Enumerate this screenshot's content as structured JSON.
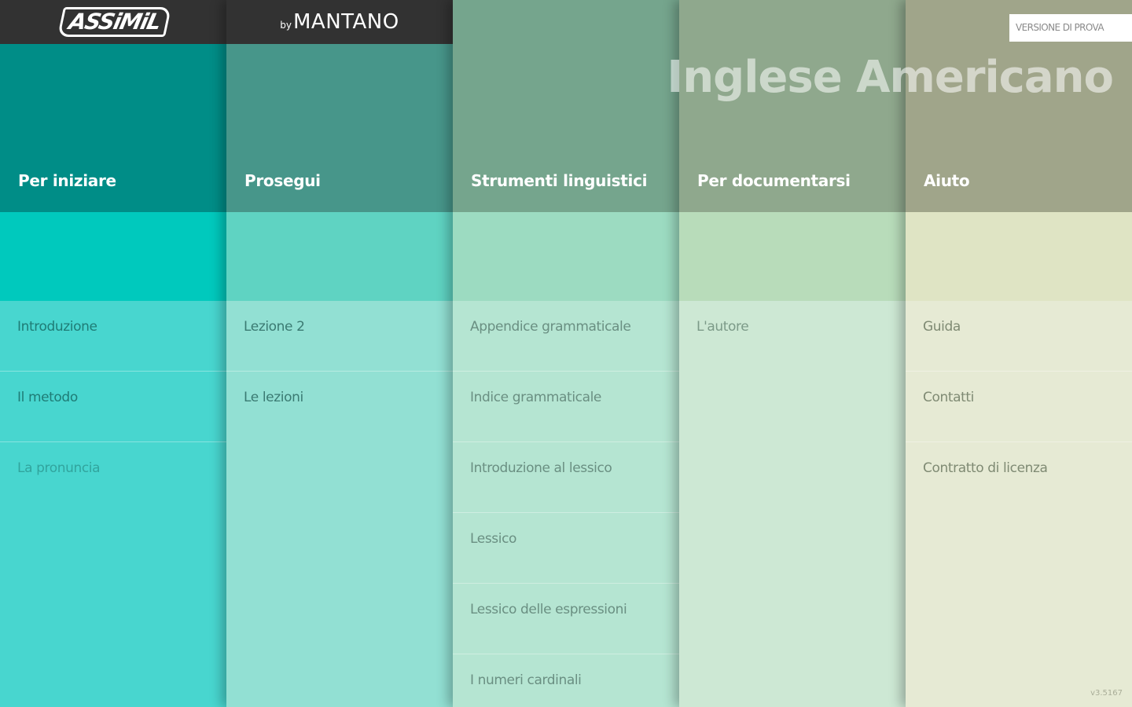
{
  "brand": {
    "logo_left": "ASSiMiL",
    "logo_right_by": "by",
    "logo_right_name": "MANTANO"
  },
  "app_title": "Inglese Americano",
  "trial_badge": "VERSIONE DI PROVA",
  "version": "v3.5167",
  "columns": [
    {
      "title": "Per iniziare",
      "items": [
        "Introduzione",
        "Il metodo",
        "La pronuncia"
      ]
    },
    {
      "title": "Prosegui",
      "items": [
        "Lezione 2",
        "Le lezioni"
      ]
    },
    {
      "title": "Strumenti linguistici",
      "items": [
        "Appendice grammaticale",
        "Indice grammaticale",
        "Introduzione al lessico",
        "Lessico",
        "Lessico delle espressioni",
        "I numeri cardinali"
      ]
    },
    {
      "title": "Per documentarsi",
      "items": [
        "L'autore"
      ]
    },
    {
      "title": "Aiuto",
      "items": [
        "Guida",
        "Contatti",
        "Contratto di licenza"
      ]
    }
  ]
}
